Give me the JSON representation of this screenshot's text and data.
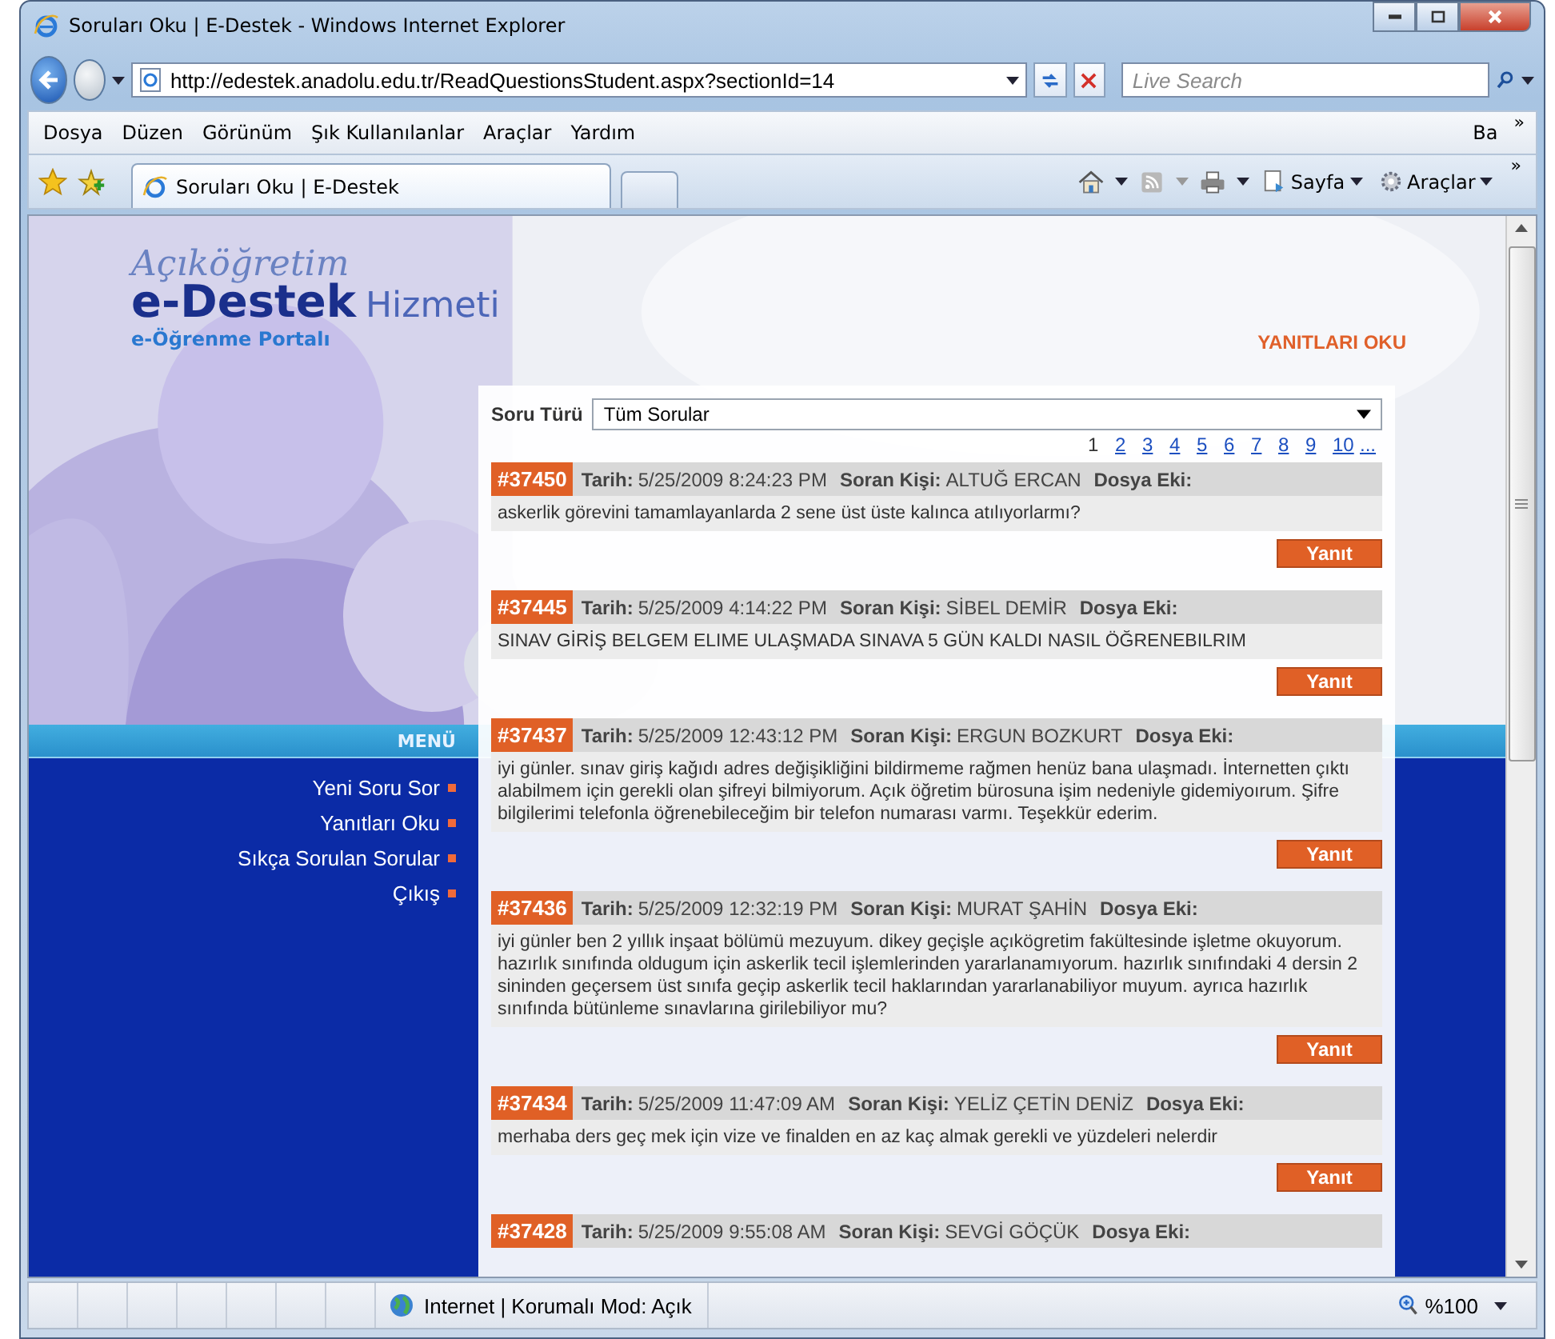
{
  "window": {
    "title": "Soruları Oku | E-Destek - Windows Internet Explorer"
  },
  "address_bar": {
    "url": "http://edestek.anadolu.edu.tr/ReadQuestionsStudent.aspx?sectionId=14"
  },
  "search": {
    "placeholder": "Live Search"
  },
  "menu_bar": {
    "items": [
      "Dosya",
      "Düzen",
      "Görünüm",
      "Şık Kullanılanlar",
      "Araçlar",
      "Yardım"
    ],
    "overflow_text": "Ba",
    "overflow_chevron": "»"
  },
  "toolbar": {
    "tabs": [
      {
        "label": "Soruları Oku | E-Destek",
        "selected": true
      }
    ],
    "page_button": "Sayfa",
    "tools_button": "Araçlar",
    "chevron": "»"
  },
  "site": {
    "logo_script": "Açıköğretim",
    "logo_title": "e-Destek",
    "logo_suffix": "Hizmeti",
    "portal": "e-Öğrenme Portalı",
    "page_title": "YANITLARI OKU"
  },
  "menu": {
    "title": "MENÜ",
    "items": [
      {
        "label": "Yeni Soru Sor"
      },
      {
        "label": "Yanıtları Oku"
      },
      {
        "label": "Sıkça Sorulan Sorular"
      },
      {
        "label": "Çıkış"
      }
    ]
  },
  "filter": {
    "label": "Soru Türü",
    "value": "Tüm Sorular"
  },
  "pagination": [
    {
      "label": "1",
      "selected": true
    },
    {
      "label": "2",
      "selected": false
    },
    {
      "label": "3",
      "selected": false
    },
    {
      "label": "4",
      "selected": false
    },
    {
      "label": "5",
      "selected": false
    },
    {
      "label": "6",
      "selected": false
    },
    {
      "label": "7",
      "selected": false
    },
    {
      "label": "8",
      "selected": false
    },
    {
      "label": "9",
      "selected": false
    },
    {
      "label": "10",
      "selected": false
    },
    {
      "label": "...",
      "selected": false
    }
  ],
  "questions": [
    {
      "id": "#37450",
      "date_label": "Tarih:",
      "date": "5/25/2009 8:24:23 PM",
      "asker_label": "Soran Kişi:",
      "asker": "ALTUĞ ERCAN",
      "attachment_label": "Dosya Eki:",
      "text": "askerlik görevini tamamlayanlarda 2 sene üst üste kalınca atılıyorlarmı?",
      "button": "Yanıt"
    },
    {
      "id": "#37445",
      "date_label": "Tarih:",
      "date": "5/25/2009 4:14:22 PM",
      "asker_label": "Soran Kişi:",
      "asker": "SİBEL DEMİR",
      "attachment_label": "Dosya Eki:",
      "text": "SINAV GİRİŞ BELGEM ELIME ULAŞMADA SINAVA 5 GÜN KALDI NASIL ÖĞRENEBILRIM",
      "button": "Yanıt"
    },
    {
      "id": "#37437",
      "date_label": "Tarih:",
      "date": "5/25/2009 12:43:12 PM",
      "asker_label": "Soran Kişi:",
      "asker": "ERGUN BOZKURT",
      "attachment_label": "Dosya Eki:",
      "text": "iyi günler. sınav giriş kağıdı adres değişikliğini bildirmeme rağmen henüz bana ulaşmadı. İnternetten çıktı alabilmem için gerekli olan şifreyi bilmiyorum. Açık öğretim bürosuna işim nedeniyle gidemiyoırum. Şifre bilgilerimi telefonla öğrenebileceğim bir telefon numarası varmı. Teşekkür ederim.",
      "button": "Yanıt"
    },
    {
      "id": "#37436",
      "date_label": "Tarih:",
      "date": "5/25/2009 12:32:19 PM",
      "asker_label": "Soran Kişi:",
      "asker": "MURAT ŞAHİN",
      "attachment_label": "Dosya Eki:",
      "text": "iyi günler ben 2 yıllık inşaat bölümü mezuyum. dikey geçişle açıkögretim fakültesinde işletme okuyorum. hazırlık sınıfında oldugum için askerlik tecil işlemlerinden yararlanamıyorum. hazırlık sınıfındaki 4 dersin 2 sininden geçersem üst sınıfa geçip askerlik tecil haklarından yararlanabiliyor muyum. ayrıca hazırlık sınıfında bütünleme sınavlarına girilebiliyor mu?",
      "button": "Yanıt"
    },
    {
      "id": "#37434",
      "date_label": "Tarih:",
      "date": "5/25/2009 11:47:09 AM",
      "asker_label": "Soran Kişi:",
      "asker": "YELİZ ÇETİN DENİZ",
      "attachment_label": "Dosya Eki:",
      "text": "merhaba ders geç mek için vize ve finalden en az kaç almak gerekli ve yüzdeleri nelerdir",
      "button": "Yanıt"
    },
    {
      "id": "#37428",
      "date_label": "Tarih:",
      "date": "5/25/2009 9:55:08 AM",
      "asker_label": "Soran Kişi:",
      "asker": "SEVGİ GÖÇÜK",
      "attachment_label": "Dosya Eki:"
    }
  ],
  "status_bar": {
    "zone": "Internet | Korumalı Mod: Açık",
    "zoom": "%100"
  }
}
